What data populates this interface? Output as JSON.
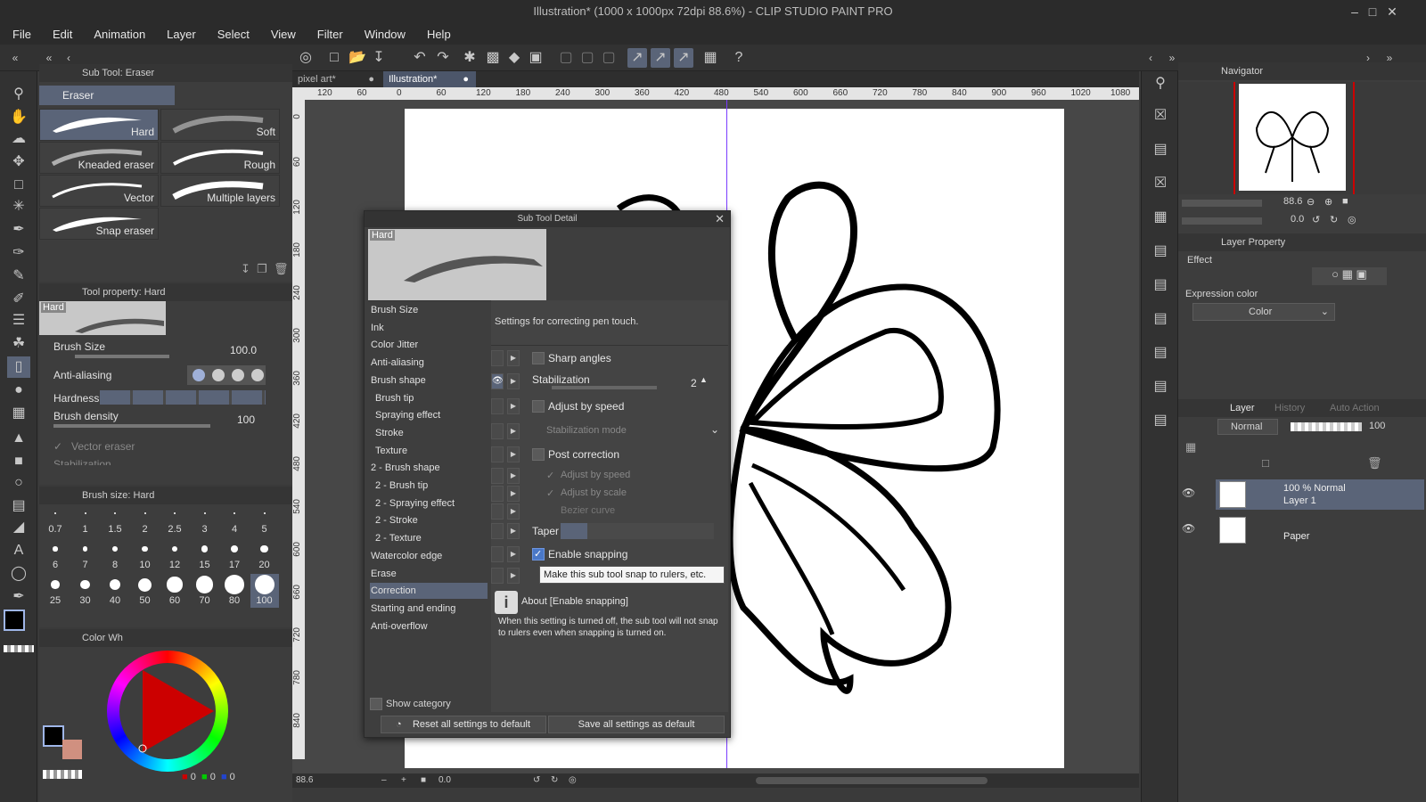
{
  "app": {
    "title": "Illustration* (1000 x 1000px 72dpi 88.6%) - CLIP STUDIO PAINT PRO",
    "window_controls": [
      "minimize-icon",
      "maximize-icon",
      "close-icon"
    ]
  },
  "menu": [
    "File",
    "Edit",
    "Animation",
    "Layer",
    "Select",
    "View",
    "Filter",
    "Window",
    "Help"
  ],
  "subtool_panel": {
    "title": "Sub Tool: Eraser",
    "group": "Eraser",
    "items": [
      {
        "label": "Hard",
        "selected": true
      },
      {
        "label": "Soft"
      },
      {
        "label": "Kneaded eraser"
      },
      {
        "label": "Rough"
      },
      {
        "label": "Vector"
      },
      {
        "label": "Multiple layers"
      },
      {
        "label": "Snap eraser"
      }
    ]
  },
  "tool_property": {
    "title": "Tool property: Hard",
    "preview_label": "Hard",
    "brush_size_label": "Brush Size",
    "brush_size_value": "100.0",
    "anti_aliasing_label": "Anti-aliasing",
    "hardness_label": "Hardness",
    "brush_density_label": "Brush density",
    "brush_density_value": "100",
    "vector_eraser_label": "Vector eraser",
    "stabilization_cut": "Stabilization"
  },
  "brush_size_panel": {
    "title": "Brush size: Hard",
    "sizes": [
      "0.7",
      "1",
      "1.5",
      "2",
      "2.5",
      "3",
      "4",
      "5",
      "6",
      "7",
      "8",
      "10",
      "12",
      "15",
      "17",
      "20",
      "25",
      "30",
      "40",
      "50",
      "60",
      "70",
      "80",
      "100"
    ],
    "selected": "100"
  },
  "color_panel": {
    "title": "Color Wh",
    "rgb_values": [
      "0",
      "0",
      "0"
    ]
  },
  "canvas": {
    "tabs": [
      {
        "label": "pixel art*",
        "active": false
      },
      {
        "label": "Illustration*",
        "active": true
      }
    ],
    "ruler_ticks": [
      "120",
      "60",
      "0",
      "60",
      "120",
      "180",
      "240",
      "300",
      "360",
      "420",
      "480",
      "540",
      "600",
      "660",
      "720",
      "780",
      "840",
      "900",
      "960",
      "1020",
      "1080"
    ],
    "vruler_ticks": [
      "0",
      "60",
      "120",
      "180",
      "240",
      "300",
      "360",
      "420",
      "480",
      "540",
      "600",
      "660",
      "720",
      "780",
      "840"
    ],
    "zoom": "88.6",
    "angle": "0.0"
  },
  "sub_tool_detail": {
    "title": "Sub Tool Detail",
    "preview_label": "Hard",
    "categories": [
      {
        "label": "Brush Size",
        "indent": false
      },
      {
        "label": "Ink",
        "indent": false
      },
      {
        "label": "Color Jitter",
        "indent": false
      },
      {
        "label": "Anti-aliasing",
        "indent": false
      },
      {
        "label": "Brush shape",
        "indent": false
      },
      {
        "label": "Brush tip",
        "indent": true
      },
      {
        "label": "Spraying effect",
        "indent": true
      },
      {
        "label": "Stroke",
        "indent": true
      },
      {
        "label": "Texture",
        "indent": true
      },
      {
        "label": "2 - Brush shape",
        "indent": false
      },
      {
        "label": "2 - Brush tip",
        "indent": true
      },
      {
        "label": "2 - Spraying effect",
        "indent": true
      },
      {
        "label": "2 - Stroke",
        "indent": true
      },
      {
        "label": "2 - Texture",
        "indent": true
      },
      {
        "label": "Watercolor edge",
        "indent": false
      },
      {
        "label": "Erase",
        "indent": false
      },
      {
        "label": "Correction",
        "indent": false,
        "selected": true
      },
      {
        "label": "Starting and ending",
        "indent": false
      },
      {
        "label": "Anti-overflow",
        "indent": false
      }
    ],
    "description": "Settings for correcting pen touch.",
    "sharp_angles": "Sharp angles",
    "stabilization": "Stabilization",
    "stabilization_value": "2",
    "adjust_by_speed": "Adjust by speed",
    "stabilization_mode": "Stabilization mode",
    "post_correction": "Post correction",
    "adjust_by_speed_2": "Adjust by speed",
    "adjust_by_scale": "Adjust by scale",
    "bezier_curve": "Bezier curve",
    "taper": "Taper",
    "enable_snapping": "Enable snapping",
    "tooltip": "Make this sub tool snap to rulers, etc.",
    "about_title": "About [Enable snapping]",
    "about_text": "When this setting is turned off, the sub tool will not snap to rulers even when snapping is turned on.",
    "show_category": "Show category",
    "reset_button": "Reset all settings to default",
    "save_button": "Save all settings as default"
  },
  "navigator": {
    "title": "Navigator",
    "zoom": "88.6",
    "angle": "0.0"
  },
  "layer_property": {
    "title": "Layer Property",
    "effect_label": "Effect",
    "expression_color_label": "Expression color",
    "expression_color_value": "Color"
  },
  "layer_panel": {
    "tabs": [
      "Layer",
      "History",
      "Auto Action"
    ],
    "blend_mode": "Normal",
    "opacity": "100",
    "layers": [
      {
        "title": "100 % Normal",
        "name": "Layer 1",
        "selected": true
      },
      {
        "title": "",
        "name": "Paper",
        "selected": false
      }
    ]
  },
  "colors": {
    "accent": "#5a6478",
    "checkbox_on": "#4a78c8",
    "canvas_bg": "#474747",
    "guide_line": "#7a3cff"
  }
}
